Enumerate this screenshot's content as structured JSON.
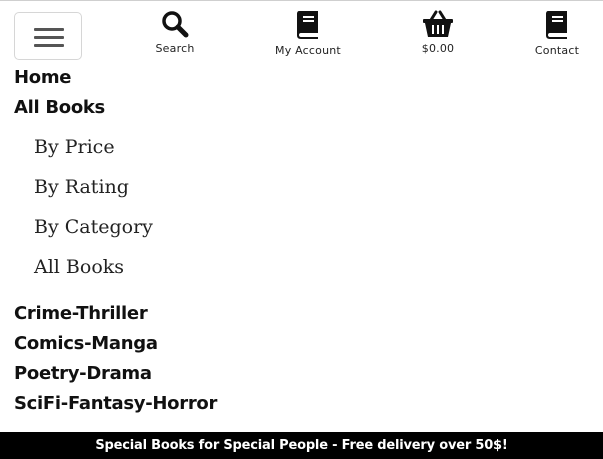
{
  "toolbar": {
    "menu_icon": "hamburger-icon",
    "search": {
      "label": "Search",
      "icon": "search-icon"
    },
    "account": {
      "label": "My Account",
      "icon": "book-icon"
    },
    "basket": {
      "label": "$0.00",
      "icon": "basket-icon"
    },
    "contact": {
      "label": "Contact",
      "icon": "book-icon"
    }
  },
  "nav": {
    "home": "Home",
    "all_books": "All Books",
    "submenu": [
      "By Price",
      "By Rating",
      "By Category",
      "All Books"
    ],
    "categories": [
      "Crime-Thriller",
      "Comics-Manga",
      "Poetry-Drama",
      "SciFi-Fantasy-Horror"
    ]
  },
  "banner": "Special Books for Special People - Free delivery over 50$!",
  "colors": {
    "footer_bg": "#000000",
    "footer_text": "#ffffff",
    "text": "#111111"
  }
}
